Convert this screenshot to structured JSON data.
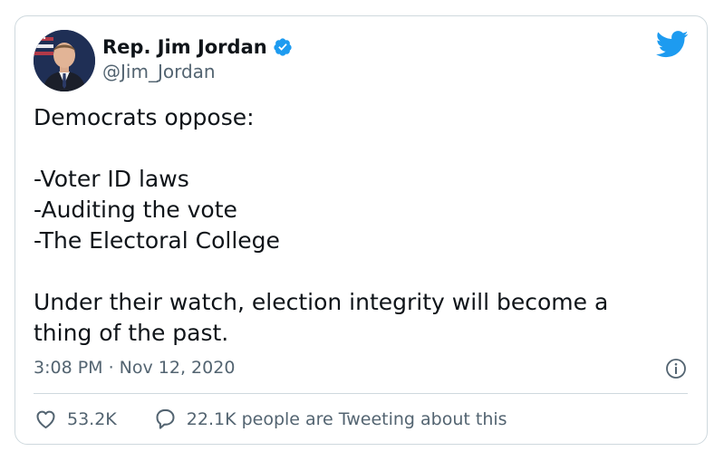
{
  "author": {
    "display_name": "Rep. Jim Jordan",
    "handle": "@Jim_Jordan",
    "verified": true,
    "avatar_icon": "avatar-portrait"
  },
  "tweet": {
    "lines": [
      "Democrats oppose:",
      "",
      "-Voter ID laws",
      "-Auditing the vote",
      "-The Electoral College",
      "",
      "Under their watch, election integrity will become a",
      "thing of the past."
    ],
    "timestamp": "3:08 PM · Nov 12, 2020"
  },
  "actions": {
    "likes": "53.2K",
    "conversation": "22.1K people are Tweeting about this"
  },
  "icons": {
    "brand": "twitter-bird-icon",
    "verified": "verified-badge-icon",
    "info": "info-icon",
    "like": "heart-icon",
    "reply": "reply-bubble-icon"
  },
  "colors": {
    "brand_blue": "#1d9bf0",
    "text_primary": "#0f1419",
    "text_secondary": "#536471",
    "border": "#cfd9de"
  }
}
